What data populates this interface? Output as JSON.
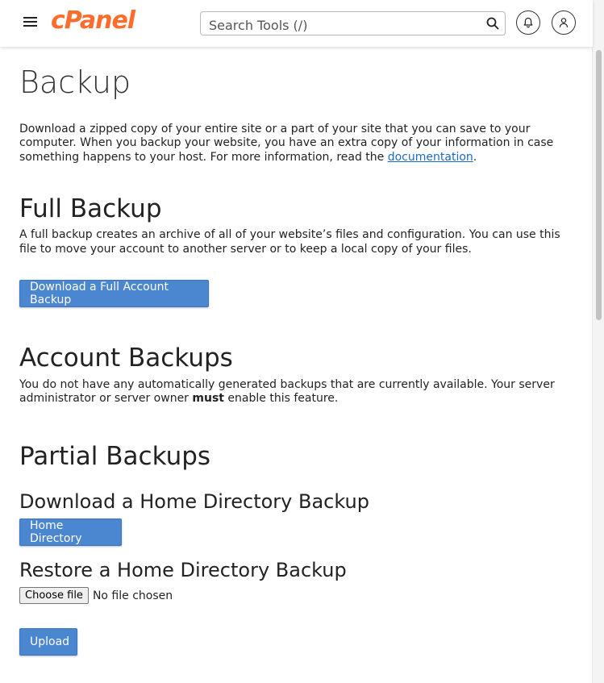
{
  "header": {
    "logo": "cPanel",
    "search_placeholder": "Search Tools (/)",
    "icons": {
      "menu": "hamburger-menu-icon",
      "search": "search-icon",
      "notifications": "bell-icon",
      "account": "user-icon"
    }
  },
  "page": {
    "title": "Backup",
    "intro_text": "Download a zipped copy of your entire site or a part of your site that you can save to your computer. When you backup your website, you have an extra copy of your information in case something happens to your host. For more information, read the ",
    "intro_link": "documentation",
    "intro_end": "."
  },
  "full_backup": {
    "heading": "Full Backup",
    "description": "A full backup creates an archive of all of your website’s files and configuration. You can use this file to move your account to another server or to keep a local copy of your files.",
    "button": "Download a Full Account Backup"
  },
  "account_backups": {
    "heading": "Account Backups",
    "description_start": "You do not have any automatically generated backups that are currently available. Your server administrator or server owner ",
    "description_bold": "must",
    "description_end": " enable this feature."
  },
  "partial_backups": {
    "heading": "Partial Backups",
    "download_heading": "Download a Home Directory Backup",
    "download_button": "Home Directory",
    "restore_heading": "Restore a Home Directory Backup",
    "choose_file_label": "Choose file",
    "no_file_text": "No file chosen",
    "upload_button": "Upload"
  },
  "colors": {
    "brand": "#ff6c2c",
    "primary_button": "#4b86d0",
    "link": "#1b6ac9"
  }
}
